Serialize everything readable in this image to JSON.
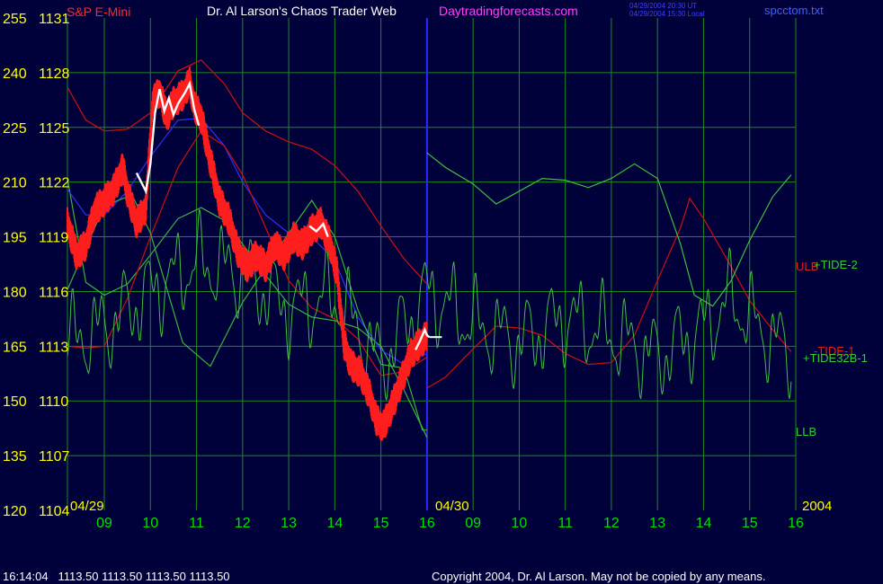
{
  "header": {
    "symbol": "S&P E-Mini",
    "title": "Dr. Al Larson's Chaos Trader Web",
    "website": "Daytradingforecasts.com",
    "timestamp_ut": "04/29/2004 20:30 UT",
    "timestamp_local": "04/29/2004 15:30 Local",
    "file": "spcctom.txt"
  },
  "footer": {
    "quote": "16:14:04   1113.50 1113.50 1113.50 1113.50",
    "copyright": "Copyright 2004, Dr. Al Larson. May not be copied by any means."
  },
  "colors": {
    "background": "#00003a",
    "grid": "#1e8a1e",
    "price_red": "#ff1e1e",
    "price_white": "#ffffff",
    "band_red": "#d01010",
    "band_green": "#3cb43c",
    "tide_green": "#40c040",
    "smooth_blue": "#3030ff",
    "divider": "#2a2aff",
    "label_yellow": "#ffff00",
    "label_green": "#00e000"
  },
  "chart_data": {
    "type": "line",
    "title": "S&P E-Mini",
    "y_left_ticks": [
      "120",
      "135",
      "150",
      "165",
      "180",
      "195",
      "210",
      "225",
      "240",
      "255"
    ],
    "y_price_ticks": [
      "1104",
      "1107",
      "1110",
      "1113",
      "1116",
      "1119",
      "1122",
      "1125",
      "1128",
      "1131"
    ],
    "ylim": [
      1104,
      1131
    ],
    "date_labels": [
      "04/29",
      "04/30",
      "2004"
    ],
    "x_ticks": [
      "09",
      "10",
      "11",
      "12",
      "13",
      "14",
      "15",
      "16",
      "09",
      "10",
      "11",
      "12",
      "13",
      "14",
      "15",
      "16"
    ],
    "xlim_hours": [
      8.2,
      24.0
    ],
    "series_labels": {
      "ulb": "ULB",
      "llb": "LLB",
      "tide2": "+TIDE-2",
      "tide1": "-TIDE-1",
      "tide32b": "+TIDE32B-1"
    },
    "price_path": [
      [
        8.2,
        1119.8
      ],
      [
        8.4,
        1118.0
      ],
      [
        8.6,
        1118.6
      ],
      [
        8.8,
        1120.5
      ],
      [
        9.0,
        1121.0
      ],
      [
        9.2,
        1121.6
      ],
      [
        9.4,
        1122.8
      ],
      [
        9.5,
        1121.5
      ],
      [
        9.7,
        1119.8
      ],
      [
        9.9,
        1120.6
      ],
      [
        10.05,
        1126.4
      ],
      [
        10.2,
        1127.0
      ],
      [
        10.35,
        1125.6
      ],
      [
        10.5,
        1126.4
      ],
      [
        10.7,
        1126.8
      ],
      [
        10.85,
        1127.5
      ],
      [
        10.95,
        1126.2
      ],
      [
        11.1,
        1125.6
      ],
      [
        11.3,
        1123.2
      ],
      [
        11.5,
        1121.0
      ],
      [
        11.7,
        1120.0
      ],
      [
        11.9,
        1118.2
      ],
      [
        12.1,
        1117.4
      ],
      [
        12.3,
        1118.0
      ],
      [
        12.5,
        1117.4
      ],
      [
        12.7,
        1118.6
      ],
      [
        12.9,
        1118.0
      ],
      [
        13.1,
        1119.0
      ],
      [
        13.3,
        1118.6
      ],
      [
        13.5,
        1119.4
      ],
      [
        13.7,
        1119.8
      ],
      [
        13.9,
        1118.6
      ],
      [
        14.05,
        1117.0
      ],
      [
        14.2,
        1113.2
      ],
      [
        14.35,
        1112.0
      ],
      [
        14.55,
        1111.6
      ],
      [
        14.75,
        1110.4
      ],
      [
        14.9,
        1109.0
      ],
      [
        15.05,
        1108.6
      ],
      [
        15.25,
        1109.8
      ],
      [
        15.45,
        1111.2
      ],
      [
        15.65,
        1112.6
      ],
      [
        15.85,
        1113.2
      ],
      [
        16.0,
        1113.6
      ],
      [
        16.05,
        1113.5
      ]
    ],
    "white_segments": [
      [
        [
          9.7,
          1122.5
        ],
        [
          9.9,
          1121.5
        ],
        [
          10.0,
          1123.0
        ],
        [
          10.1,
          1125.8
        ],
        [
          10.2,
          1127.1
        ],
        [
          10.3,
          1125.9
        ],
        [
          10.4,
          1126.6
        ],
        [
          10.5,
          1125.7
        ],
        [
          10.6,
          1126.3
        ],
        [
          10.75,
          1126.9
        ],
        [
          10.85,
          1127.4
        ],
        [
          10.95,
          1126.0
        ],
        [
          11.05,
          1125.1
        ]
      ],
      [
        [
          13.45,
          1119.6
        ],
        [
          13.6,
          1119.3
        ],
        [
          13.75,
          1119.7
        ],
        [
          13.85,
          1119.0
        ]
      ],
      [
        [
          15.75,
          1112.8
        ],
        [
          15.85,
          1113.3
        ],
        [
          15.95,
          1113.9
        ],
        [
          16.0,
          1113.6
        ],
        [
          16.05,
          1113.5
        ]
      ]
    ],
    "series": [
      {
        "name": "ULB",
        "color": "#d01010",
        "points": [
          [
            8.2,
            1127.2
          ],
          [
            8.6,
            1125.4
          ],
          [
            9.0,
            1124.8
          ],
          [
            9.5,
            1124.9
          ],
          [
            10.0,
            1125.8
          ],
          [
            10.6,
            1128.1
          ],
          [
            11.1,
            1128.7
          ],
          [
            11.6,
            1127.4
          ],
          [
            12.0,
            1125.8
          ],
          [
            12.5,
            1124.8
          ],
          [
            13.0,
            1124.2
          ],
          [
            13.5,
            1123.8
          ],
          [
            14.0,
            1122.9
          ],
          [
            14.5,
            1121.5
          ],
          [
            15.0,
            1119.6
          ],
          [
            15.5,
            1117.8
          ],
          [
            16.0,
            1116.4
          ]
        ]
      },
      {
        "name": "Lower band",
        "color": "#3cb43c",
        "points": [
          [
            8.2,
            1122.2
          ],
          [
            8.6,
            1116.5
          ],
          [
            9.0,
            1115.8
          ],
          [
            9.5,
            1116.4
          ],
          [
            10.0,
            1118.0
          ],
          [
            10.6,
            1120.0
          ],
          [
            11.1,
            1120.6
          ],
          [
            11.6,
            1119.9
          ],
          [
            12.0,
            1118.6
          ],
          [
            12.5,
            1116.9
          ],
          [
            13.0,
            1115.3
          ],
          [
            13.5,
            1114.6
          ],
          [
            14.0,
            1114.4
          ],
          [
            14.5,
            1114.0
          ],
          [
            15.0,
            1113.0
          ],
          [
            15.5,
            1110.6
          ],
          [
            16.0,
            1108.0
          ]
        ]
      },
      {
        "name": "Smoothed",
        "color": "#3030ff",
        "points": [
          [
            8.2,
            1121.6
          ],
          [
            8.6,
            1120.2
          ],
          [
            9.0,
            1120.2
          ],
          [
            9.5,
            1121.5
          ],
          [
            10.0,
            1123.4
          ],
          [
            10.6,
            1125.4
          ],
          [
            11.1,
            1125.5
          ],
          [
            11.6,
            1124.0
          ],
          [
            12.0,
            1122.0
          ],
          [
            12.5,
            1120.2
          ],
          [
            13.0,
            1119.2
          ],
          [
            13.5,
            1119.0
          ],
          [
            14.0,
            1117.7
          ],
          [
            14.5,
            1114.6
          ],
          [
            15.0,
            1112.8
          ],
          [
            15.5,
            1112.0
          ],
          [
            16.0,
            1112.6
          ]
        ]
      },
      {
        "name": "Mid red",
        "color": "#d01010",
        "points": [
          [
            8.2,
            1113.0
          ],
          [
            8.6,
            1112.9
          ],
          [
            9.0,
            1113.0
          ],
          [
            9.5,
            1115.6
          ],
          [
            10.0,
            1119.0
          ],
          [
            10.6,
            1122.8
          ],
          [
            11.1,
            1124.8
          ],
          [
            11.6,
            1124.0
          ],
          [
            12.0,
            1122.4
          ],
          [
            12.5,
            1119.5
          ],
          [
            13.0,
            1116.6
          ],
          [
            13.5,
            1115.1
          ],
          [
            14.0,
            1114.5
          ],
          [
            14.5,
            1113.4
          ],
          [
            15.0,
            1111.4
          ],
          [
            15.5,
            1111.6
          ],
          [
            16.0,
            1112.4
          ]
        ]
      },
      {
        "name": "-TIDE-1",
        "color": "#d01010",
        "points": [
          [
            16.0,
            1110.7
          ],
          [
            16.4,
            1111.3
          ],
          [
            16.9,
            1112.6
          ],
          [
            17.5,
            1114.1
          ],
          [
            18.0,
            1114.0
          ],
          [
            18.5,
            1113.6
          ],
          [
            19.0,
            1112.6
          ],
          [
            19.5,
            1112.0
          ],
          [
            20.0,
            1112.1
          ],
          [
            20.5,
            1113.6
          ],
          [
            21.0,
            1116.6
          ],
          [
            21.5,
            1119.5
          ],
          [
            21.7,
            1121.1
          ],
          [
            22.0,
            1120.0
          ],
          [
            22.5,
            1117.8
          ],
          [
            23.0,
            1115.5
          ],
          [
            23.5,
            1113.9
          ],
          [
            23.9,
            1112.7
          ]
        ]
      },
      {
        "name": "+TIDE-2",
        "color": "#40c040",
        "points": [
          [
            16.0,
            1123.6
          ],
          [
            16.4,
            1122.8
          ],
          [
            17.0,
            1121.9
          ],
          [
            17.5,
            1120.8
          ],
          [
            18.0,
            1121.5
          ],
          [
            18.5,
            1122.2
          ],
          [
            19.0,
            1122.1
          ],
          [
            19.5,
            1121.7
          ],
          [
            20.0,
            1122.2
          ],
          [
            20.5,
            1123.0
          ],
          [
            21.0,
            1122.2
          ],
          [
            21.5,
            1118.6
          ],
          [
            21.8,
            1115.8
          ],
          [
            22.2,
            1115.2
          ],
          [
            22.6,
            1116.6
          ],
          [
            23.0,
            1118.8
          ],
          [
            23.5,
            1121.2
          ],
          [
            23.9,
            1122.4
          ]
        ]
      },
      {
        "name": "LLB",
        "color": "#3cb43c",
        "points": [
          [
            8.2,
            1116.1
          ],
          [
            9.0,
            1120.7
          ],
          [
            9.6,
            1121.3
          ],
          [
            10.0,
            1119.2
          ],
          [
            10.7,
            1113.2
          ],
          [
            11.3,
            1111.9
          ],
          [
            12.0,
            1115.4
          ],
          [
            13.0,
            1119.2
          ],
          [
            13.5,
            1121.0
          ],
          [
            14.0,
            1119.0
          ],
          [
            14.5,
            1115.0
          ],
          [
            15.0,
            1112.0
          ],
          [
            15.5,
            1111.8
          ],
          [
            15.9,
            1108.4
          ],
          [
            16.0,
            1108.4
          ]
        ]
      }
    ],
    "tide32b": {
      "name": "+TIDE32B-1",
      "color": "#40c040",
      "base_points": [
        [
          8.2,
          1113.2
        ],
        [
          9.0,
          1114.0
        ],
        [
          10.0,
          1116.0
        ],
        [
          11.0,
          1117.6
        ],
        [
          12.0,
          1117.0
        ],
        [
          13.0,
          1115.0
        ],
        [
          14.0,
          1115.8
        ],
        [
          15.0,
          1112.0
        ],
        [
          16.0,
          1116.0
        ],
        [
          17.0,
          1114.2
        ],
        [
          18.0,
          1113.2
        ],
        [
          19.0,
          1114.6
        ],
        [
          20.0,
          1113.6
        ],
        [
          21.0,
          1112.4
        ],
        [
          22.0,
          1114.0
        ],
        [
          22.6,
          1115.6
        ],
        [
          23.2,
          1114.0
        ],
        [
          23.9,
          1112.6
        ]
      ]
    }
  }
}
